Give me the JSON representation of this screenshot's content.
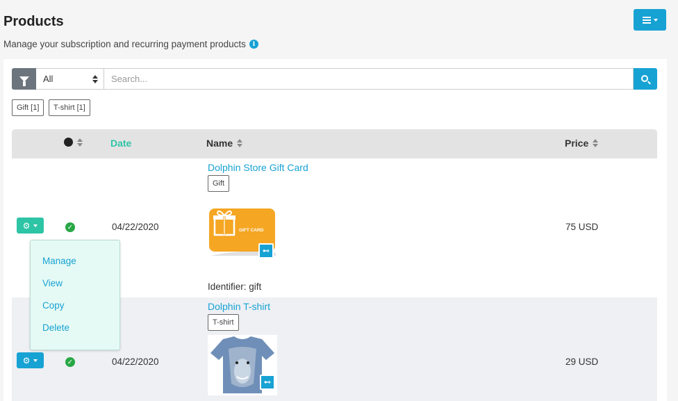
{
  "header": {
    "title": "Products",
    "subtitle": "Manage your subscription and recurring payment products",
    "info_icon": "i"
  },
  "filter": {
    "select_value": "All",
    "search_placeholder": "Search..."
  },
  "tags": [
    "Gift [1]",
    "T-shirt [1]"
  ],
  "table": {
    "headers": {
      "date": "Date",
      "name": "Name",
      "price": "Price"
    }
  },
  "rows": [
    {
      "date": "04/22/2020",
      "name": "Dolphin Store Gift Card",
      "tag": "Gift",
      "image_text": "GIFT CARD",
      "identifier": "Identifier: gift",
      "price": "75 USD"
    },
    {
      "date": "04/22/2020",
      "name": "Dolphin T-shirt",
      "tag": "T-shirt",
      "price": "29 USD"
    }
  ],
  "dropdown": {
    "items": [
      "Manage",
      "View",
      "Copy",
      "Delete"
    ]
  },
  "colors": {
    "accent_blue": "#17a2d4",
    "accent_green": "#2ec4a6",
    "gift_orange": "#f5a623"
  }
}
